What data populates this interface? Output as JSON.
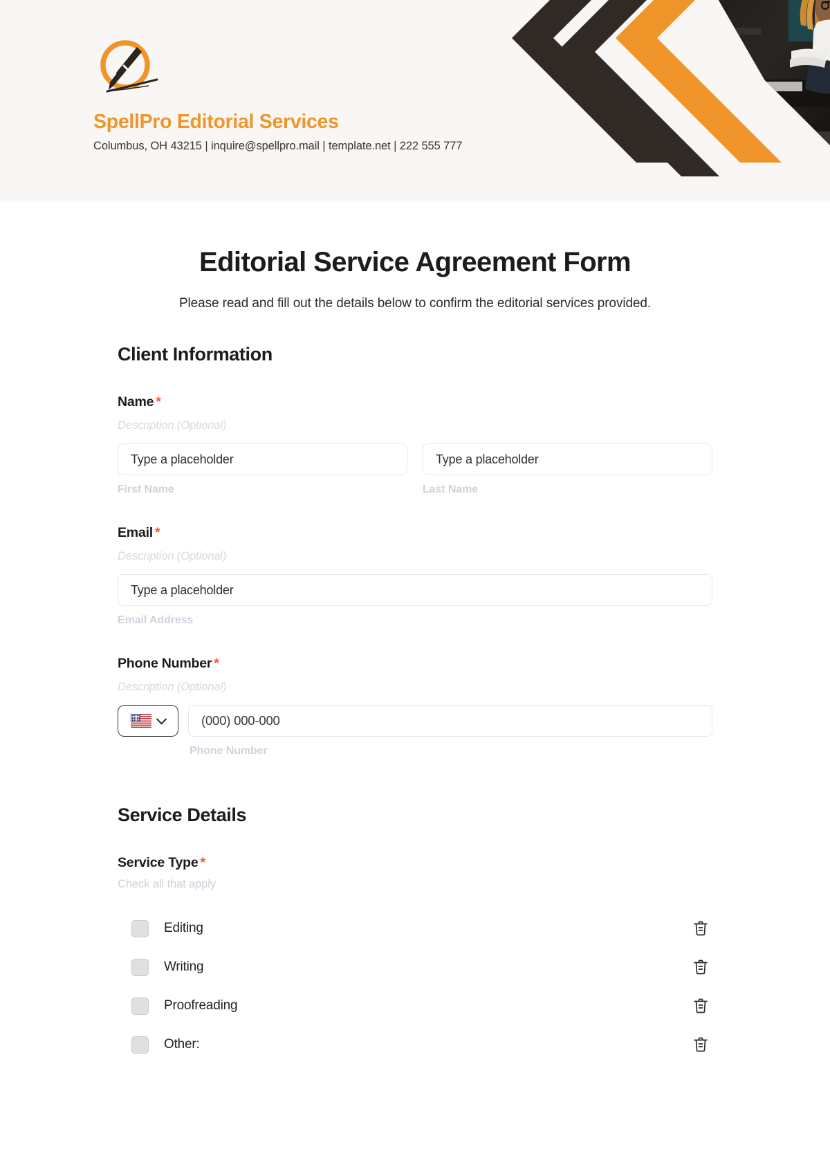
{
  "brand": {
    "name": "SpellPro Editorial Services",
    "contact": "Columbus, OH 43215 | inquire@spellpro.mail | template.net | 222 555 777",
    "accent_color": "#f0952a",
    "dark_color": "#312a24",
    "header_bg": "#f8f7f5"
  },
  "form": {
    "title": "Editorial Service Agreement Form",
    "subtitle": "Please read and fill out the details below to confirm the editorial services provided.",
    "required_marker": "*",
    "required_color": "#f4583c"
  },
  "sections": {
    "client_information": {
      "heading": "Client Information",
      "fields": {
        "name": {
          "label": "Name",
          "required": true,
          "description": "Description (Optional)",
          "inputs": [
            {
              "placeholder": "Type a placeholder",
              "value": "",
              "sub_label": "First Name"
            },
            {
              "placeholder": "Type a placeholder",
              "value": "",
              "sub_label": "Last Name"
            }
          ]
        },
        "email": {
          "label": "Email",
          "required": true,
          "description": "Description (Optional)",
          "inputs": [
            {
              "placeholder": "Type a placeholder",
              "value": "",
              "sub_label": "Email Address"
            }
          ]
        },
        "phone": {
          "label": "Phone Number",
          "required": true,
          "description": "Description (Optional)",
          "country_flag": "us-flag-icon",
          "placeholder": "(000) 000-000",
          "value": "",
          "sub_label": "Phone Number"
        }
      }
    },
    "service_details": {
      "heading": "Service Details",
      "fields": {
        "service_type": {
          "label": "Service Type",
          "required": true,
          "hint": "Check all that apply",
          "options": [
            {
              "label": "Editing",
              "checked": false,
              "delete_icon": "trash-icon"
            },
            {
              "label": "Writing",
              "checked": false,
              "delete_icon": "trash-icon"
            },
            {
              "label": "Proofreading",
              "checked": false,
              "delete_icon": "trash-icon"
            },
            {
              "label": "Other:",
              "checked": false,
              "delete_icon": "trash-icon"
            }
          ]
        }
      }
    }
  }
}
